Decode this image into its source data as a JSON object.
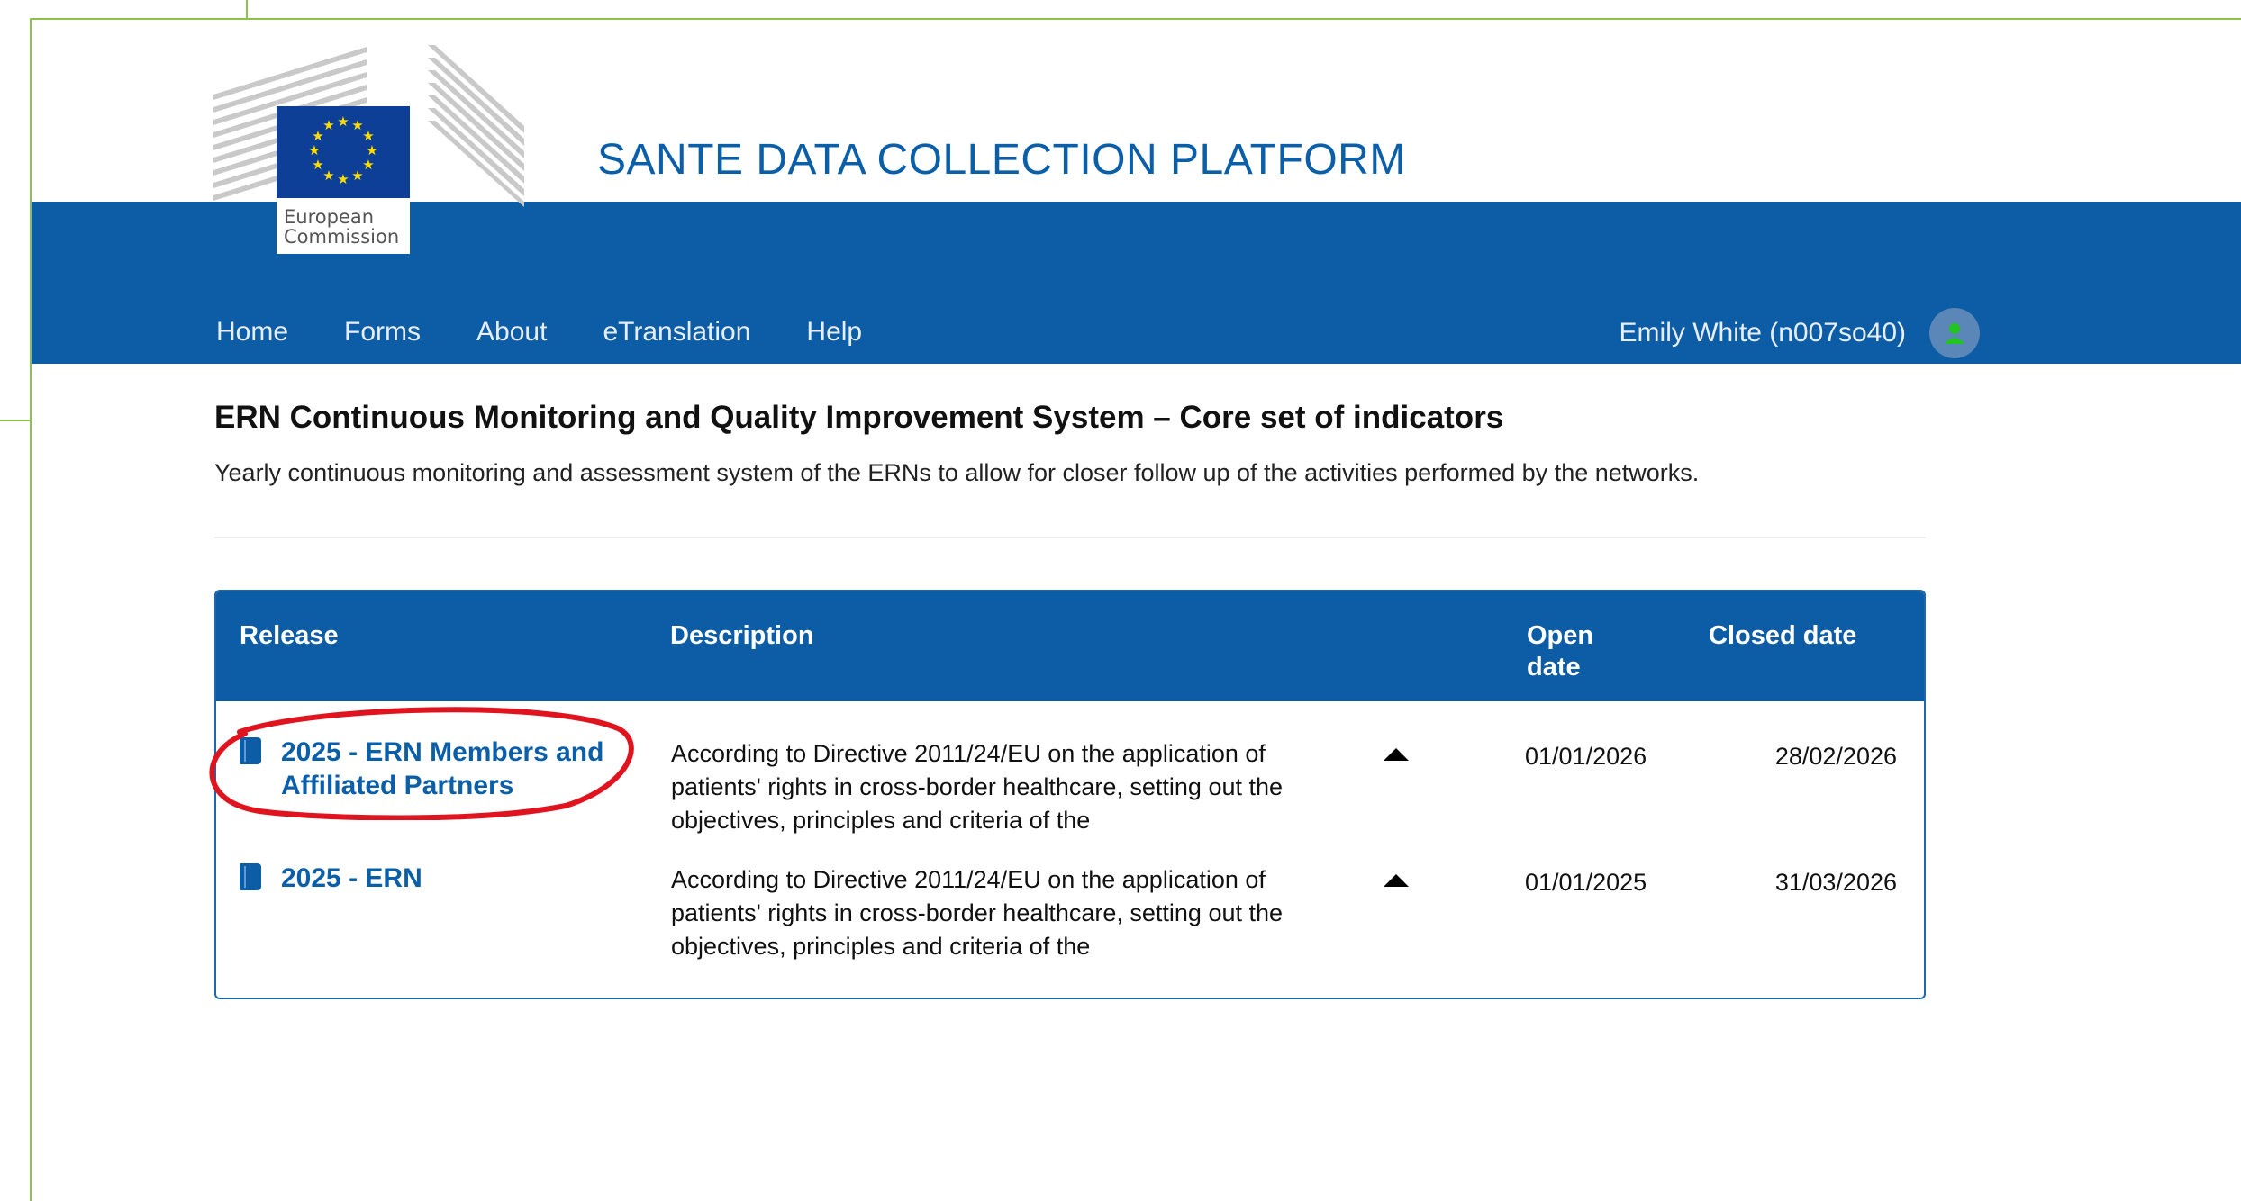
{
  "header": {
    "logo_text": [
      "European",
      "Commission"
    ],
    "site_title": "SANTE DATA COLLECTION PLATFORM",
    "nav": [
      "Home",
      "Forms",
      "About",
      "eTranslation",
      "Help"
    ],
    "user": "Emily White (n007so40)",
    "user_icon": "user-icon",
    "brand_color": "#0c5da5"
  },
  "page": {
    "heading": "ERN Continuous Monitoring and Quality Improvement System – Core set of indicators",
    "description": "Yearly continuous monitoring and assessment system of the ERNs to allow for closer follow up of the activities performed by the networks."
  },
  "table": {
    "columns": {
      "release": "Release",
      "description": "Description",
      "open_line1": "Open",
      "open_line2": "date",
      "closed": "Closed date"
    },
    "rows": [
      {
        "release_line1": "2025 - ERN Members and",
        "release_line2": "Affiliated Partners",
        "desc_line1": "According to Directive 2011/24/EU on the application of",
        "desc_line2": "patients' rights in cross-border healthcare, setting out the",
        "desc_line3": "objectives, principles and criteria of the",
        "open": "01/01/2026",
        "closed": "28/02/2026"
      },
      {
        "release_line1": "2025 - ERN",
        "release_line2": "",
        "desc_line1": "According to Directive 2011/24/EU on the application of",
        "desc_line2": "patients' rights in cross-border healthcare, setting out the",
        "desc_line3": "objectives, principles and criteria of the",
        "open": "01/01/2025",
        "closed": "31/03/2026"
      }
    ]
  },
  "annotation_color": "#e0141e"
}
